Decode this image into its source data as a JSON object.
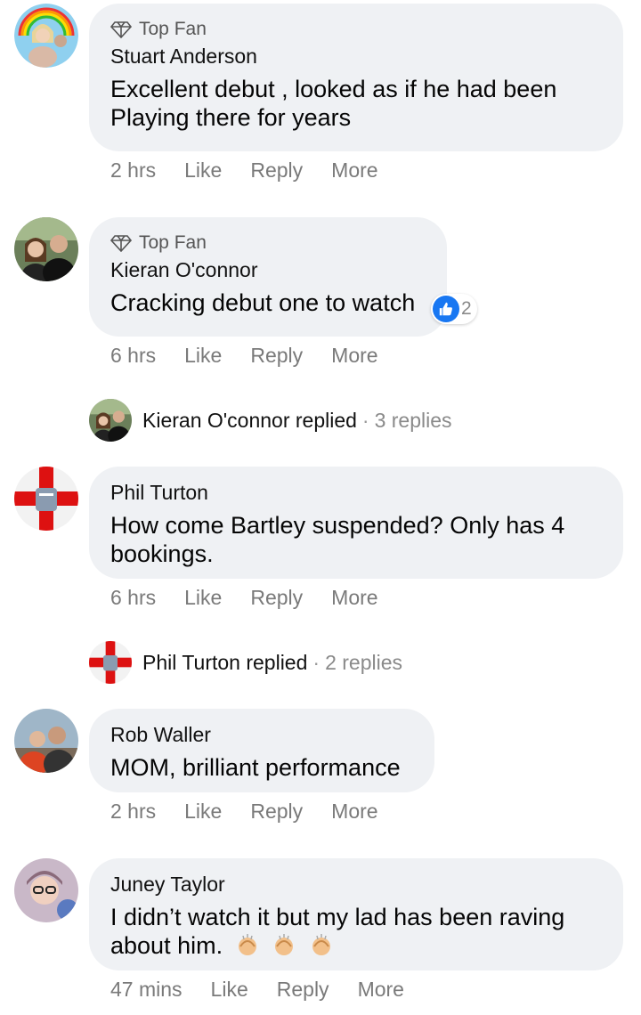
{
  "comments": [
    {
      "badge": "Top Fan",
      "author": "Stuart Anderson",
      "text": "Excellent debut , looked as if he had been Playing there for years",
      "time": "2 hrs",
      "like": "Like",
      "reply": "Reply",
      "more": "More"
    },
    {
      "badge": "Top Fan",
      "author": "Kieran O'connor",
      "text": "Cracking debut one to watch",
      "reaction_count": "2",
      "time": "6 hrs",
      "like": "Like",
      "reply": "Reply",
      "more": "More",
      "replies_author": "Kieran O'connor replied",
      "replies_count": "3 replies"
    },
    {
      "author": "Phil Turton",
      "text": "How come Bartley suspended? Only has 4 bookings.",
      "time": "6 hrs",
      "like": "Like",
      "reply": "Reply",
      "more": "More",
      "replies_author": "Phil Turton replied",
      "replies_count": "2 replies"
    },
    {
      "author": "Rob Waller",
      "text": "MOM, brilliant performance",
      "time": "2 hrs",
      "like": "Like",
      "reply": "Reply",
      "more": "More"
    },
    {
      "author": "Juney Taylor",
      "text": "I didn’t watch it but my lad has been raving about him.",
      "emoji": "👏👏👏",
      "time": "47 mins",
      "like": "Like",
      "reply": "Reply",
      "more": "More"
    }
  ],
  "dot": "·",
  "colors": {
    "bubble": "#eff1f4",
    "meta": "#7a7a7a",
    "like_blue": "#1877f2"
  }
}
